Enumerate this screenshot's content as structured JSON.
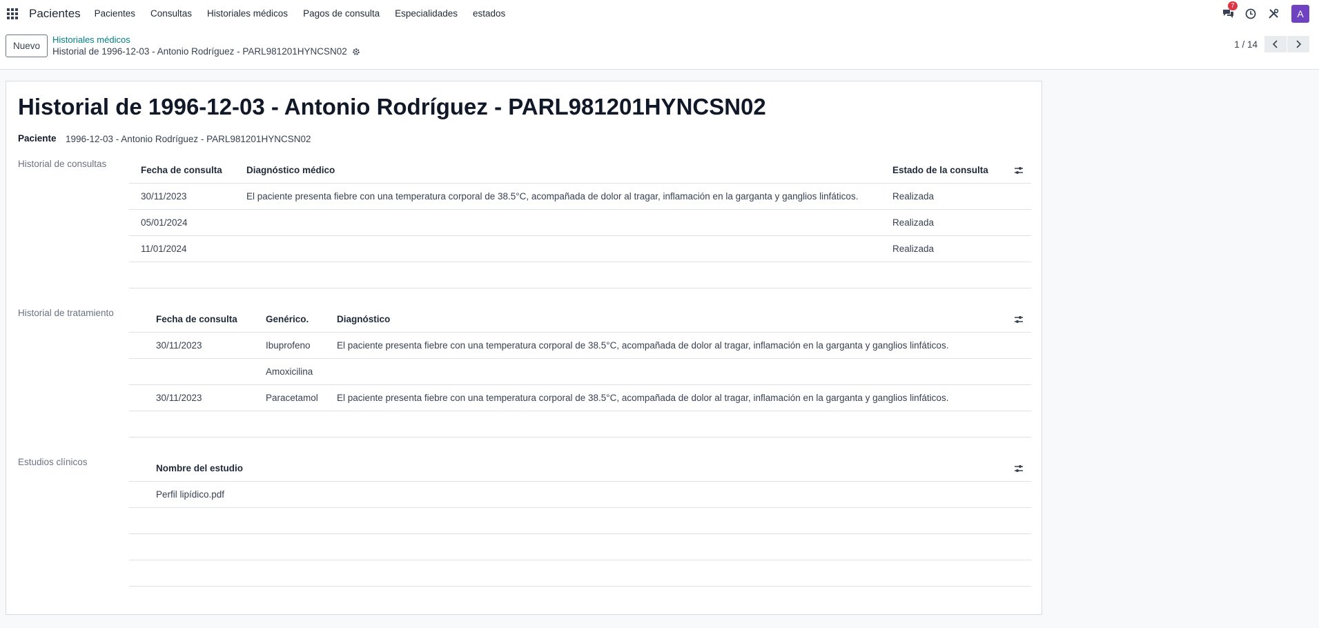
{
  "navbar": {
    "brand": "Pacientes",
    "menu": [
      "Pacientes",
      "Consultas",
      "Historiales médicos",
      "Pagos de consulta",
      "Especialidades",
      "estados"
    ],
    "messages_badge": "7",
    "avatar_letter": "A",
    "avatar_color": "#6f42c1"
  },
  "control": {
    "new_button": "Nuevo",
    "breadcrumb_parent": "Historiales médicos",
    "breadcrumb_current": "Historial de 1996-12-03 - Antonio Rodríguez - PARL981201HYNCSN02",
    "pager": "1 / 14"
  },
  "form": {
    "title": "Historial de 1996-12-03 - Antonio Rodríguez - PARL981201HYNCSN02",
    "patient_label": "Paciente",
    "patient_value": "1996-12-03 - Antonio Rodríguez - PARL981201HYNCSN02",
    "consultas": {
      "label": "Historial de consultas",
      "headers": [
        "Fecha de consulta",
        "Diagnóstico médico",
        "Estado de la consulta"
      ],
      "rows": [
        [
          "30/11/2023",
          "El paciente presenta fiebre con una temperatura corporal de 38.5°C, acompañada de dolor al tragar, inflamación en la garganta y ganglios linfáticos.",
          "Realizada"
        ],
        [
          "05/01/2024",
          "",
          "Realizada"
        ],
        [
          "11/01/2024",
          "",
          "Realizada"
        ]
      ]
    },
    "tratamiento": {
      "label": "Historial de tratamiento",
      "headers": [
        "Fecha de consulta",
        "Genérico.",
        "Diagnóstico"
      ],
      "rows": [
        [
          "30/11/2023",
          "Ibuprofeno",
          "El paciente presenta fiebre con una temperatura corporal de 38.5°C, acompañada de dolor al tragar, inflamación en la garganta y ganglios linfáticos."
        ],
        [
          "",
          "Amoxicilina",
          ""
        ],
        [
          "30/11/2023",
          "Paracetamol",
          "El paciente presenta fiebre con una temperatura corporal de 38.5°C, acompañada de dolor al tragar, inflamación en la garganta y ganglios linfáticos."
        ]
      ]
    },
    "estudios": {
      "label": "Estudios clínicos",
      "headers": [
        "Nombre del estudio"
      ],
      "rows": [
        [
          "Perfil lipídico.pdf"
        ]
      ]
    }
  }
}
